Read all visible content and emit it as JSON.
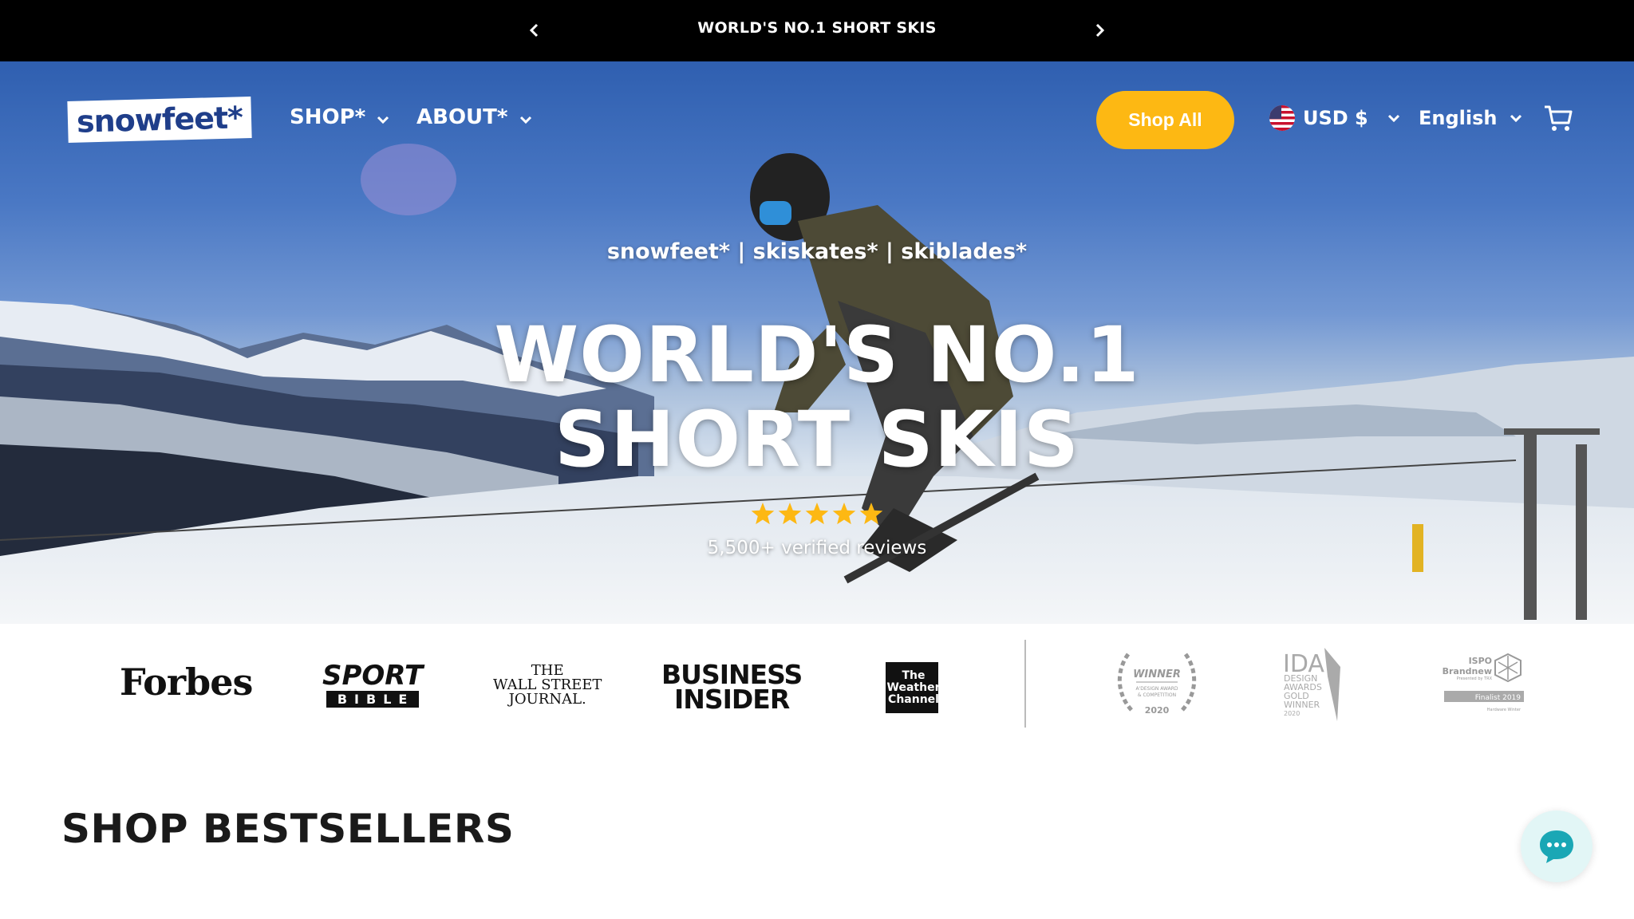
{
  "announcement": {
    "message": "WORLD'S NO.1 SHORT SKIS",
    "prev_icon": "chevron-left-icon",
    "next_icon": "chevron-right-icon"
  },
  "header": {
    "logo_text": "snowfeet*",
    "nav": [
      {
        "label": "SHOP*",
        "icon": "chevron-down-icon"
      },
      {
        "label": "ABOUT*",
        "icon": "chevron-down-icon"
      }
    ],
    "shop_all_label": "Shop All",
    "currency": "USD $",
    "currency_flag": "us-flag-icon",
    "language": "English",
    "cart_icon": "cart-icon",
    "accent_color": "#fdb813"
  },
  "hero": {
    "brands_line": "snowfeet* | skiskates* | skiblades*",
    "title_line1": "WORLD'S NO.1",
    "title_line2": "SHORT SKIS",
    "rating_stars": 5,
    "star_color": "#fdb813",
    "reviews_text": "5,500+ verified reviews"
  },
  "press": {
    "logos": [
      "Forbes",
      "SPORT",
      "BIBLE",
      "THE",
      "WALL STREET",
      "JOURNAL.",
      "BUSINESS",
      "INSIDER",
      "The",
      "Weather",
      "Channel"
    ],
    "awards": {
      "a_design": {
        "title": "WINNER",
        "line1": "A'DESIGN AWARD",
        "line2": "& COMPETITION",
        "year": "2020"
      },
      "ida": {
        "title": "IDA",
        "line1": "DESIGN",
        "line2": "AWARDS",
        "line3": "GOLD",
        "line4": "WINNER",
        "year": "2020"
      },
      "ispo": {
        "title": "ISPO",
        "line1": "Brandnew",
        "line2": "Presented by TRX",
        "badge": "Finalist 2019",
        "line3": "Hardware Winter"
      }
    }
  },
  "section": {
    "title": "SHOP BESTSELLERS"
  },
  "chat": {
    "icon": "chat-bubble-icon",
    "color": "#1aa7b5"
  }
}
